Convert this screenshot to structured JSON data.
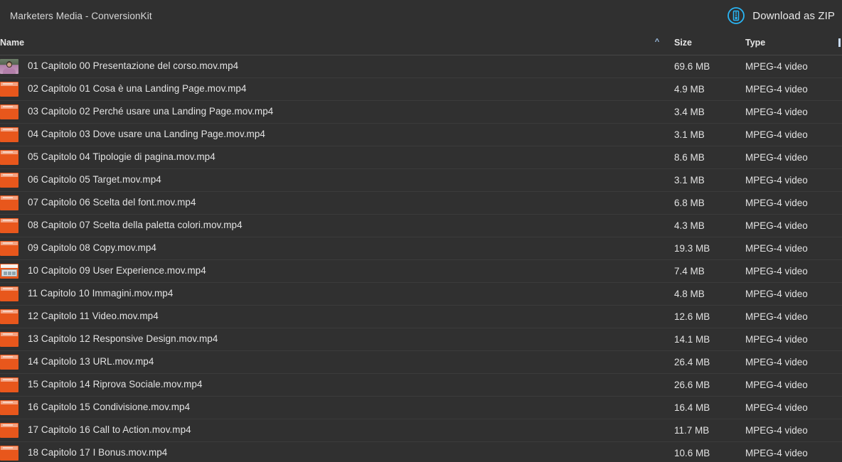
{
  "window": {
    "title": "Marketers Media - ConversionKit"
  },
  "toolbar": {
    "download_zip_label": "Download as ZIP",
    "download_zip_icon": "zip-download-icon",
    "accent_color": "#29b6f6"
  },
  "table": {
    "columns": {
      "name": "Name",
      "size": "Size",
      "type": "Type"
    },
    "sort": {
      "column": "Name",
      "direction": "ascending",
      "indicator": "^"
    },
    "rows": [
      {
        "icon": "photo-thumbnail",
        "name": "01 Capitolo 00 Presentazione del corso.mov.mp4",
        "size": "69.6 MB",
        "type": "MPEG-4 video"
      },
      {
        "icon": "video-file-icon",
        "name": "02 Capitolo 01 Cosa è una Landing Page.mov.mp4",
        "size": "4.9 MB",
        "type": "MPEG-4 video"
      },
      {
        "icon": "video-file-icon",
        "name": "03 Capitolo 02 Perché usare una Landing Page.mov.mp4",
        "size": "3.4 MB",
        "type": "MPEG-4 video"
      },
      {
        "icon": "video-file-icon",
        "name": "04 Capitolo 03 Dove usare una Landing Page.mov.mp4",
        "size": "3.1 MB",
        "type": "MPEG-4 video"
      },
      {
        "icon": "video-file-icon",
        "name": "05 Capitolo 04 Tipologie di pagina.mov.mp4",
        "size": "8.6 MB",
        "type": "MPEG-4 video"
      },
      {
        "icon": "video-file-icon",
        "name": "06 Capitolo 05 Target.mov.mp4",
        "size": "3.1 MB",
        "type": "MPEG-4 video"
      },
      {
        "icon": "video-file-icon",
        "name": "07 Capitolo 06 Scelta del font.mov.mp4",
        "size": "6.8 MB",
        "type": "MPEG-4 video"
      },
      {
        "icon": "video-file-icon",
        "name": "08 Capitolo 07 Scelta della paletta colori.mov.mp4",
        "size": "4.3 MB",
        "type": "MPEG-4 video"
      },
      {
        "icon": "video-file-icon",
        "name": "09 Capitolo 08 Copy.mov.mp4",
        "size": "19.3 MB",
        "type": "MPEG-4 video"
      },
      {
        "icon": "screen-thumbnail",
        "name": "10 Capitolo 09 User Experience.mov.mp4",
        "size": "7.4 MB",
        "type": "MPEG-4 video"
      },
      {
        "icon": "video-file-icon",
        "name": "11 Capitolo 10 Immagini.mov.mp4",
        "size": "4.8 MB",
        "type": "MPEG-4 video"
      },
      {
        "icon": "video-file-icon",
        "name": "12 Capitolo 11 Video.mov.mp4",
        "size": "12.6 MB",
        "type": "MPEG-4 video"
      },
      {
        "icon": "video-file-icon",
        "name": "13 Capitolo 12 Responsive Design.mov.mp4",
        "size": "14.1 MB",
        "type": "MPEG-4 video"
      },
      {
        "icon": "video-file-icon",
        "name": "14 Capitolo 13 URL.mov.mp4",
        "size": "26.4 MB",
        "type": "MPEG-4 video"
      },
      {
        "icon": "video-file-icon",
        "name": "15 Capitolo 14 Riprova Sociale.mov.mp4",
        "size": "26.6 MB",
        "type": "MPEG-4 video"
      },
      {
        "icon": "video-file-icon",
        "name": "16 Capitolo 15 Condivisione.mov.mp4",
        "size": "16.4 MB",
        "type": "MPEG-4 video"
      },
      {
        "icon": "video-file-icon",
        "name": "17 Capitolo 16 Call to Action.mov.mp4",
        "size": "11.7 MB",
        "type": "MPEG-4 video"
      },
      {
        "icon": "video-file-icon",
        "name": "18 Capitolo 17 I Bonus.mov.mp4",
        "size": "10.6 MB",
        "type": "MPEG-4 video"
      }
    ]
  }
}
